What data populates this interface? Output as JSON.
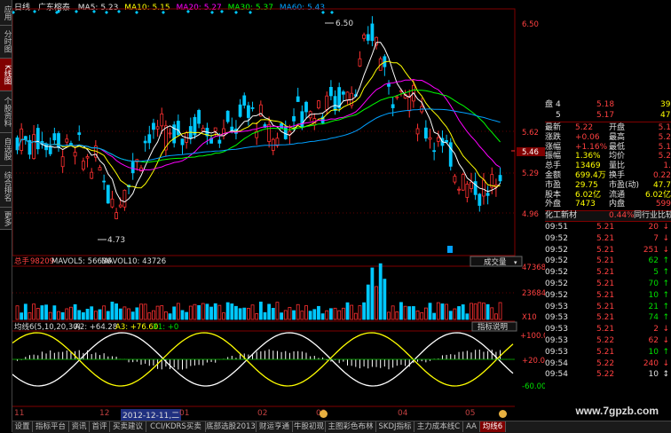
{
  "tabs_left": [
    "应用",
    "分时图",
    "K线图",
    "个股资料",
    "自选股",
    "综合排名",
    "更多"
  ],
  "header": {
    "period": "日线",
    "stock_name": "广东榕泰",
    "ma5": "MA5: 5.23",
    "ma10": "MA10: 5.15",
    "ma20": "MA20: 5.27",
    "ma30": "MA30: 5.37",
    "ma60": "MA60: 5.43"
  },
  "price_axis": [
    "6.50",
    "5.62",
    "5.46",
    "5.29",
    "4.96",
    "4.73"
  ],
  "markers": {
    "high": "6.50",
    "low": "4.73"
  },
  "volume": {
    "label_total": "总手",
    "total": "98209",
    "mavol5": "MAVOL5: 56636",
    "mavol10": "MAVOL10: 43726",
    "dropdown": "成交量",
    "axis": [
      "47368",
      "23684",
      "X10"
    ]
  },
  "indicator": {
    "name": "均线6(5,10,20,30)",
    "a2": "A2: +64.28",
    "a3": "A3: +76.60",
    "x1": "X1: +0",
    "help": "指标说明",
    "axis": [
      "+100.0",
      "+20.00",
      "-60.00"
    ]
  },
  "x_labels": [
    "11",
    "12",
    "2012-12-11,二",
    "01",
    "02",
    "03",
    "04",
    "05"
  ],
  "quote": {
    "pan_label": "盘",
    "buy": {
      "label": "4",
      "price": "5.18",
      "vol": "39"
    },
    "sell": {
      "label": "5",
      "price": "5.17",
      "vol": "47"
    },
    "rows": [
      [
        "最新",
        "5.22",
        "开盘",
        "5.1"
      ],
      [
        "涨跌",
        "+0.06",
        "最高",
        "5.2"
      ],
      [
        "涨幅",
        "+1.16%",
        "最低",
        "5.1"
      ],
      [
        "振幅",
        "1.36%",
        "均价",
        "5.2"
      ],
      [
        "总手",
        "13469",
        "量比",
        "1."
      ],
      [
        "金额",
        "699.4万",
        "换手",
        "0.22"
      ],
      [
        "市盈",
        "29.75",
        "市盈(动)",
        "47.7"
      ],
      [
        "股本",
        "6.02亿",
        "流通",
        "6.02亿"
      ],
      [
        "外盘",
        "7473",
        "内盘",
        "599"
      ]
    ],
    "industry": "化工新材",
    "industry_pct": "0.44%",
    "compare": "同行业比较"
  },
  "ticks": [
    [
      "09:51",
      "5.21",
      "20",
      "down"
    ],
    [
      "09:52",
      "5.21",
      "7",
      "down"
    ],
    [
      "09:52",
      "5.21",
      "251",
      "down"
    ],
    [
      "09:52",
      "5.21",
      "62",
      "up"
    ],
    [
      "09:52",
      "5.21",
      "5",
      "up"
    ],
    [
      "09:52",
      "5.21",
      "70",
      "up"
    ],
    [
      "09:52",
      "5.21",
      "10",
      "up"
    ],
    [
      "09:53",
      "5.21",
      "21",
      "up"
    ],
    [
      "09:53",
      "5.21",
      "74",
      "up"
    ],
    [
      "09:53",
      "5.21",
      "2",
      "down"
    ],
    [
      "09:53",
      "5.22",
      "62",
      "down"
    ],
    [
      "09:53",
      "5.21",
      "10",
      "up"
    ],
    [
      "09:54",
      "5.22",
      "240",
      "down"
    ],
    [
      "09:54",
      "5.22",
      "10",
      "neutral"
    ]
  ],
  "bottom_tabs": [
    "设置",
    "指标平台",
    "资讯",
    "首评",
    "买卖建议",
    "CCI/KDRS买卖",
    "底部选股2013",
    "财运亨通",
    "牛股初现",
    "主图彩色布林",
    "SKDJ指标",
    "主力成本线C",
    "AA",
    "均线6"
  ],
  "watermark": "www.7gpzb.com",
  "colors": {
    "up": "#ff3030",
    "down": "#00c8ff",
    "ma5": "#ffffff",
    "ma10": "#ffff00",
    "ma20": "#ff00ff",
    "ma30": "#00ff00",
    "ma60": "#00a0ff"
  }
}
